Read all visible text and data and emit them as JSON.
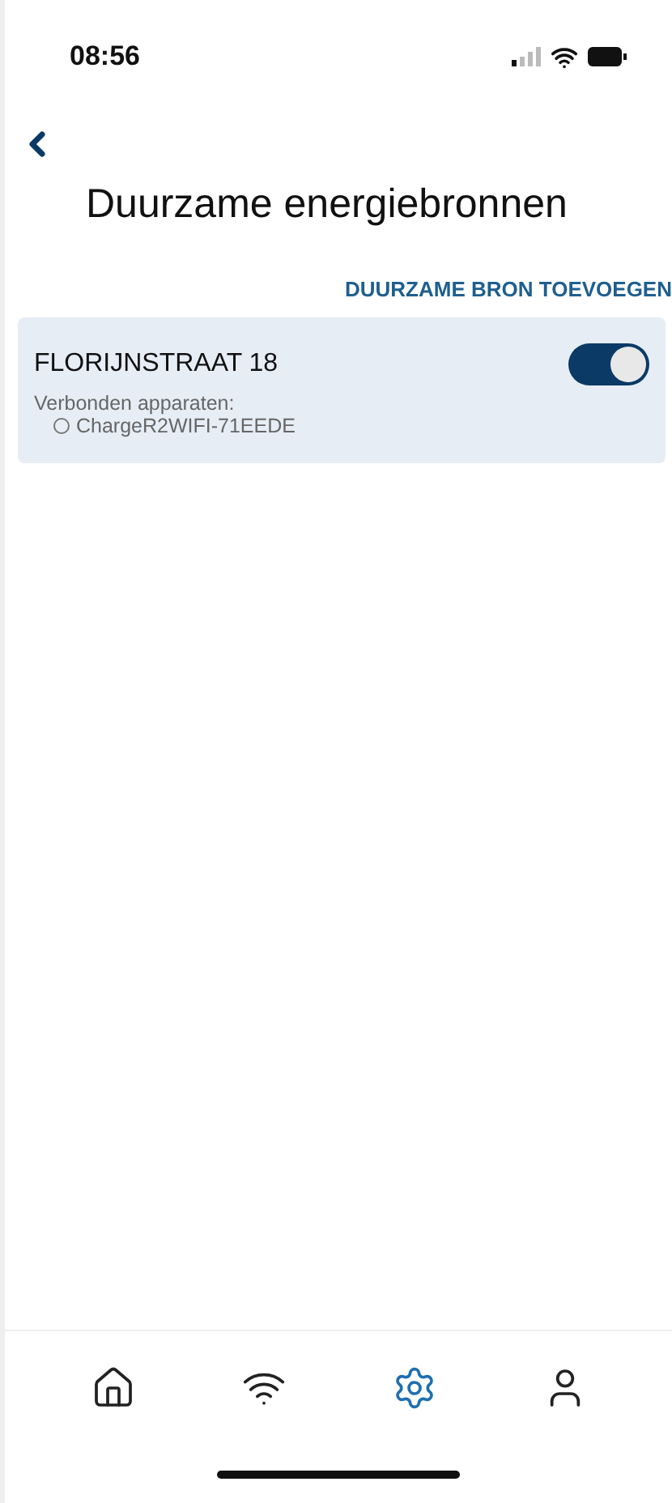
{
  "status_bar": {
    "time": "08:56"
  },
  "title": "Duurzame energiebronnen",
  "add_button": "DUURZAME BRON TOEVOEGEN",
  "sources": [
    {
      "name": "FLORIJNSTRAAT 18",
      "on": true,
      "devices_label": "Verbonden apparaten:",
      "devices": [
        "ChargeR2WIFI-71EEDE"
      ]
    }
  ],
  "tabs": [
    {
      "kind": "home",
      "selected": false
    },
    {
      "kind": "wifi",
      "selected": false
    },
    {
      "kind": "settings",
      "selected": true
    },
    {
      "kind": "profile",
      "selected": false
    }
  ]
}
